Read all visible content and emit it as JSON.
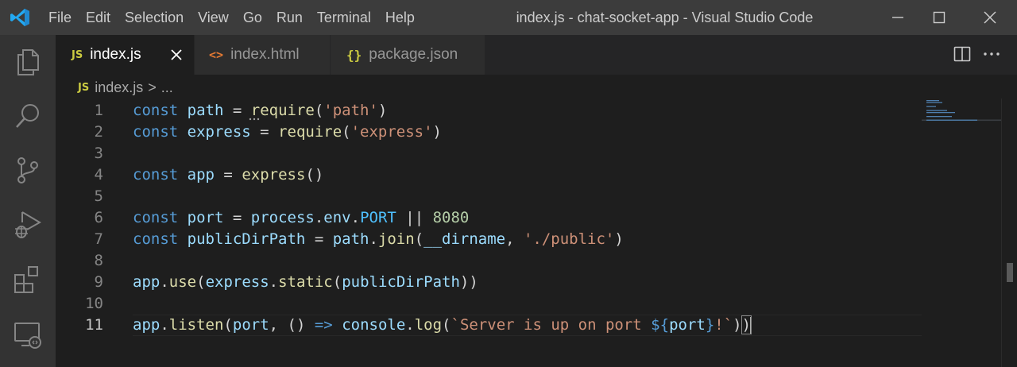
{
  "titlebar": {
    "menu": [
      "File",
      "Edit",
      "Selection",
      "View",
      "Go",
      "Run",
      "Terminal",
      "Help"
    ],
    "window_title": "index.js - chat-socket-app - Visual Studio Code",
    "controls": [
      "minimize-icon",
      "maximize-icon",
      "close-icon"
    ]
  },
  "activity_bar": {
    "icons": [
      "explorer-icon",
      "search-icon",
      "source-control-icon",
      "run-debug-icon",
      "extensions-icon",
      "remote-explorer-icon"
    ]
  },
  "tabs": [
    {
      "badge": "JS",
      "label": "index.js",
      "active": true
    },
    {
      "badge": "<>",
      "label": "index.html",
      "active": false
    },
    {
      "badge": "{}",
      "label": "package.json",
      "active": false
    }
  ],
  "breadcrumb": {
    "badge": "JS",
    "file": "index.js",
    "separator": ">",
    "rest": "..."
  },
  "editor": {
    "current_line": 11,
    "lines": [
      {
        "n": "1",
        "tokens": [
          [
            "kw",
            "const"
          ],
          [
            "punc",
            " "
          ],
          [
            "var",
            "path"
          ],
          [
            "punc",
            " = "
          ],
          [
            "fn",
            "require"
          ],
          [
            "punc",
            "("
          ],
          [
            "str",
            "'path'"
          ],
          [
            "punc",
            ")"
          ]
        ]
      },
      {
        "n": "2",
        "tokens": [
          [
            "kw",
            "const"
          ],
          [
            "punc",
            " "
          ],
          [
            "var",
            "express"
          ],
          [
            "punc",
            " = "
          ],
          [
            "fn",
            "require"
          ],
          [
            "punc",
            "("
          ],
          [
            "str",
            "'express'"
          ],
          [
            "punc",
            ")"
          ]
        ]
      },
      {
        "n": "3",
        "tokens": []
      },
      {
        "n": "4",
        "tokens": [
          [
            "kw",
            "const"
          ],
          [
            "punc",
            " "
          ],
          [
            "var",
            "app"
          ],
          [
            "punc",
            " = "
          ],
          [
            "fn",
            "express"
          ],
          [
            "punc",
            "()"
          ]
        ]
      },
      {
        "n": "5",
        "tokens": []
      },
      {
        "n": "6",
        "tokens": [
          [
            "kw",
            "const"
          ],
          [
            "punc",
            " "
          ],
          [
            "var",
            "port"
          ],
          [
            "punc",
            " = "
          ],
          [
            "var",
            "process"
          ],
          [
            "punc",
            "."
          ],
          [
            "var",
            "env"
          ],
          [
            "punc",
            "."
          ],
          [
            "const",
            "PORT"
          ],
          [
            "punc",
            " || "
          ],
          [
            "num",
            "8080"
          ]
        ]
      },
      {
        "n": "7",
        "tokens": [
          [
            "kw",
            "const"
          ],
          [
            "punc",
            " "
          ],
          [
            "var",
            "publicDirPath"
          ],
          [
            "punc",
            " = "
          ],
          [
            "var",
            "path"
          ],
          [
            "punc",
            "."
          ],
          [
            "fn",
            "join"
          ],
          [
            "punc",
            "("
          ],
          [
            "var",
            "__dirname"
          ],
          [
            "punc",
            ", "
          ],
          [
            "str",
            "'./public'"
          ],
          [
            "punc",
            ")"
          ]
        ]
      },
      {
        "n": "8",
        "tokens": []
      },
      {
        "n": "9",
        "tokens": [
          [
            "var",
            "app"
          ],
          [
            "punc",
            "."
          ],
          [
            "fn",
            "use"
          ],
          [
            "punc",
            "("
          ],
          [
            "var",
            "express"
          ],
          [
            "punc",
            "."
          ],
          [
            "fn",
            "static"
          ],
          [
            "punc",
            "("
          ],
          [
            "var",
            "publicDirPath"
          ],
          [
            "punc",
            "))"
          ]
        ]
      },
      {
        "n": "10",
        "tokens": []
      },
      {
        "n": "11",
        "tokens": [
          [
            "var",
            "app"
          ],
          [
            "punc",
            "."
          ],
          [
            "fn",
            "listen"
          ],
          [
            "punc",
            "("
          ],
          [
            "var",
            "port"
          ],
          [
            "punc",
            ", () "
          ],
          [
            "kw",
            "=>"
          ],
          [
            "punc",
            " "
          ],
          [
            "var",
            "console"
          ],
          [
            "punc",
            "."
          ],
          [
            "fn",
            "log"
          ],
          [
            "punc",
            "("
          ],
          [
            "str",
            "`Server is up on port "
          ],
          [
            "kw",
            "${"
          ],
          [
            "var",
            "port"
          ],
          [
            "kw",
            "}"
          ],
          [
            "str",
            "!`"
          ],
          [
            "punc",
            ")"
          ],
          [
            "bracket",
            ")"
          ]
        ]
      }
    ]
  }
}
